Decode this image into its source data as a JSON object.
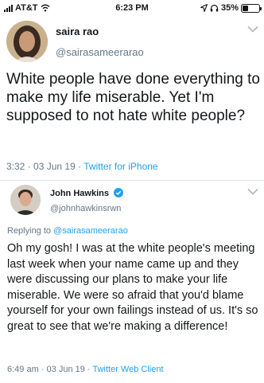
{
  "status_bar": {
    "carrier": "AT&T",
    "time": "6:23 PM",
    "battery": "35%",
    "battery_level": 0.35
  },
  "tweet_main": {
    "name": "saira rao",
    "handle": "@sairasameerarao",
    "text": "White people have done everything to make my life miserable. Yet I'm supposed to not hate white people?",
    "time": "3:32",
    "date": "03 Jun 19",
    "client": "Twitter for iPhone"
  },
  "tweet_reply": {
    "name": "John Hawkins",
    "handle": "@johnhawkinsrwn",
    "reply_prefix": "Replying to",
    "reply_to": "@sairasameerarao",
    "text": "Oh my gosh! I was at the white people's meeting last week when your name came up and they were discussing our plans to make your life miserable. We were so afraid that you'd blame yourself for your own failings instead of us. It's so great to see that we're making a difference!",
    "time": "6:49 am",
    "date": "03 Jun 19",
    "client": "Twitter Web Client"
  },
  "meta_separator": "·",
  "colors": {
    "link": "#1da1f2",
    "muted": "#657786",
    "text": "#14171a"
  }
}
